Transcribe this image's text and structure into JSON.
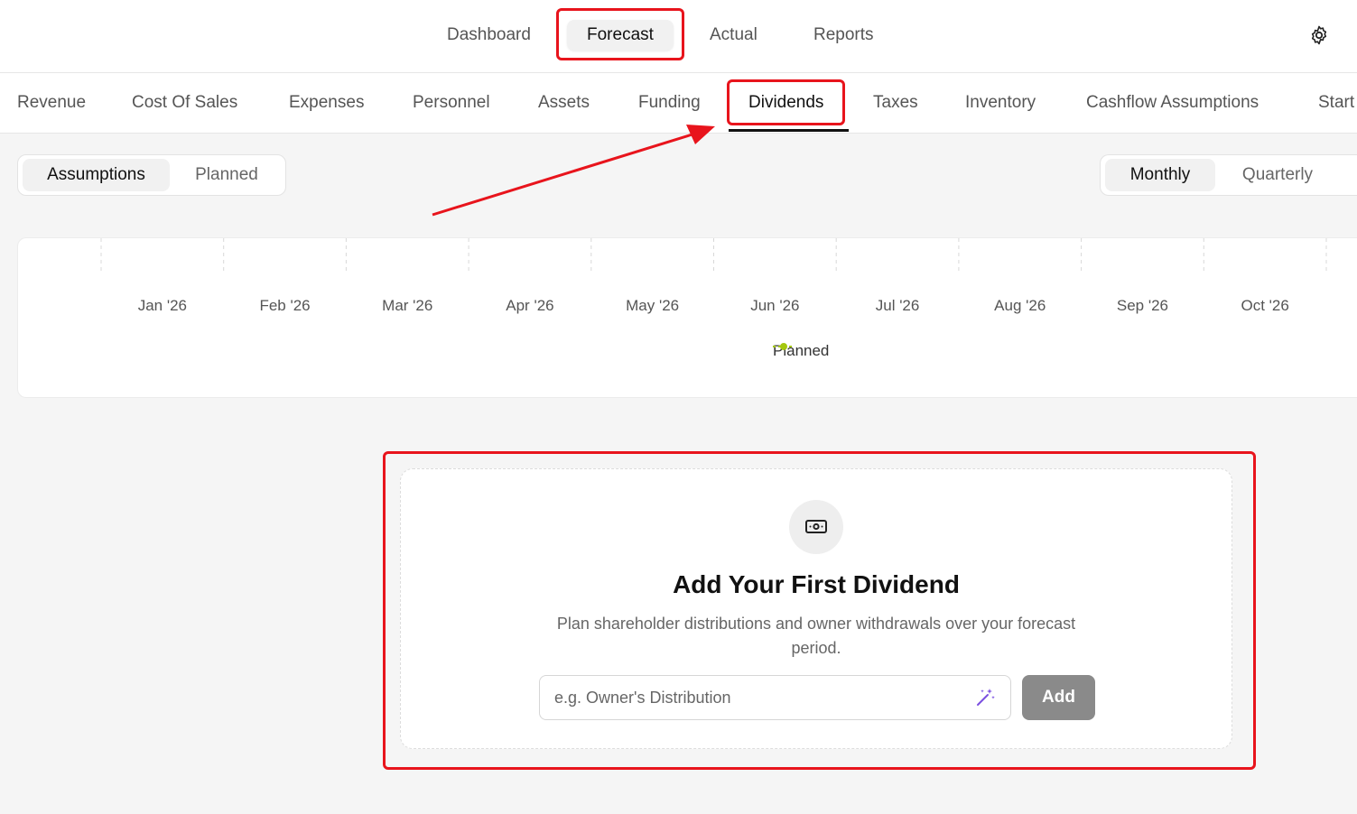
{
  "top_nav": {
    "items": [
      {
        "label": "Dashboard"
      },
      {
        "label": "Forecast",
        "active": true
      },
      {
        "label": "Actual"
      },
      {
        "label": "Reports"
      }
    ],
    "settings_icon": "gear-icon"
  },
  "sub_tabs": {
    "items": [
      {
        "label": "Revenue"
      },
      {
        "label": "Cost Of Sales"
      },
      {
        "label": "Expenses"
      },
      {
        "label": "Personnel"
      },
      {
        "label": "Assets"
      },
      {
        "label": "Funding"
      },
      {
        "label": "Dividends",
        "active": true
      },
      {
        "label": "Taxes"
      },
      {
        "label": "Inventory"
      },
      {
        "label": "Cashflow Assumptions"
      },
      {
        "label": "Start"
      }
    ]
  },
  "view_toggle": {
    "options": [
      "Assumptions",
      "Planned"
    ],
    "selected": "Assumptions"
  },
  "period_toggle": {
    "options": [
      "Monthly",
      "Quarterly"
    ],
    "selected": "Monthly"
  },
  "chart_data": {
    "type": "line",
    "categories": [
      "Jan '26",
      "Feb '26",
      "Mar '26",
      "Apr '26",
      "May '26",
      "Jun '26",
      "Jul '26",
      "Aug '26",
      "Sep '26",
      "Oct '26"
    ],
    "series": [
      {
        "name": "Planned",
        "values": [],
        "color": "#a4c70f"
      }
    ],
    "legend": "bottom-center",
    "grid": true
  },
  "empty_state": {
    "icon": "banknote-icon",
    "title": "Add Your First Dividend",
    "description": "Plan shareholder distributions and owner withdrawals over your forecast period.",
    "input_placeholder": "e.g. Owner's Distribution",
    "input_icon": "magic-wand-icon",
    "add_label": "Add"
  },
  "colors": {
    "annotation": "#e8141c",
    "add_button": "#8a8a8a",
    "legend_planned": "#a4c70f"
  }
}
